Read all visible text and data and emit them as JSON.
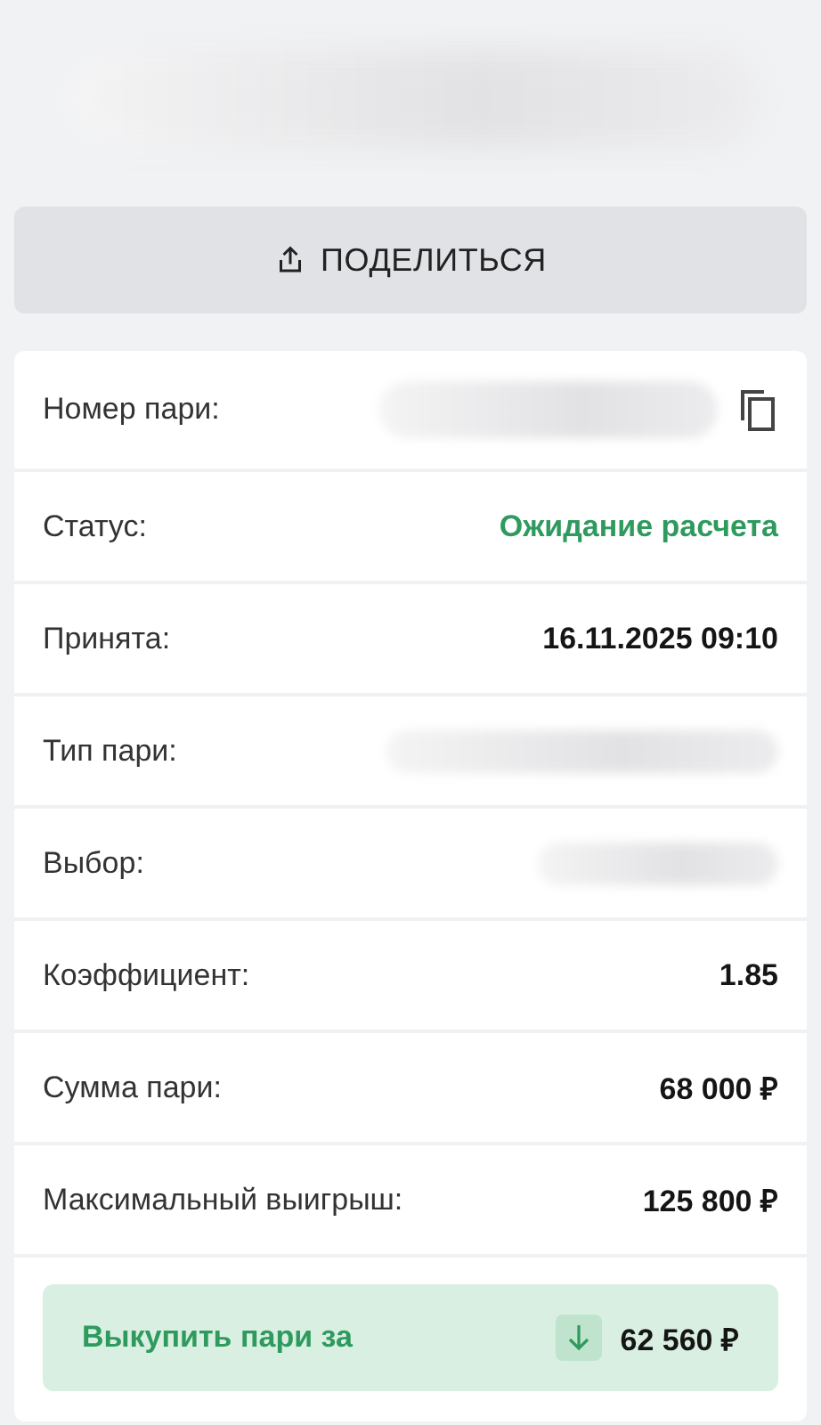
{
  "header": {
    "kind": "redacted"
  },
  "share_button": {
    "label": "ПОДЕЛИТЬСЯ"
  },
  "details": [
    {
      "label": "Номер пари:",
      "kind": "hidden_copy"
    },
    {
      "label": "Статус:",
      "kind": "status",
      "value": "Ожидание расчета"
    },
    {
      "label": "Принята:",
      "kind": "text",
      "value": "16.11.2025 09:10"
    },
    {
      "label": "Тип пари:",
      "kind": "hidden"
    },
    {
      "label": "Выбор:",
      "kind": "hidden"
    },
    {
      "label": "Коэффициент:",
      "kind": "text",
      "value": "1.85"
    },
    {
      "label": "Сумма пари:",
      "kind": "text",
      "value": "68 000 ₽"
    },
    {
      "label": "Максимальный выигрыш:",
      "kind": "text",
      "value": "125 800 ₽"
    }
  ],
  "buyout": {
    "label": "Выкупить пари за",
    "amount": "62 560 ₽"
  }
}
